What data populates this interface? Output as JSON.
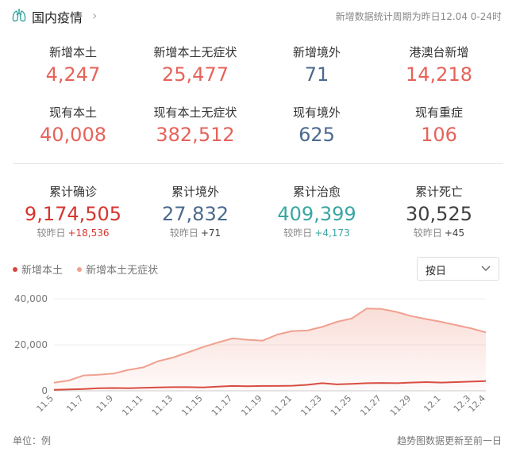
{
  "header": {
    "title": "国内疫情",
    "period": "新增数据统计周期为昨日12.04 0-24时"
  },
  "colors": {
    "red": "#e5635a",
    "blue": "#4a6a8e",
    "teal": "#3aa6a2",
    "dark": "#3f3f3f",
    "darkred": "#d6352f",
    "lightred": "#f0a08f"
  },
  "stats_new": [
    {
      "label": "新增本土",
      "value": "4,247",
      "color": "red"
    },
    {
      "label": "新增本土无症状",
      "value": "25,477",
      "color": "red"
    },
    {
      "label": "新增境外",
      "value": "71",
      "color": "blue"
    },
    {
      "label": "港澳台新增",
      "value": "14,218",
      "color": "red"
    }
  ],
  "stats_current": [
    {
      "label": "现有本土",
      "value": "40,008",
      "color": "red"
    },
    {
      "label": "现有本土无症状",
      "value": "382,512",
      "color": "red"
    },
    {
      "label": "现有境外",
      "value": "625",
      "color": "blue"
    },
    {
      "label": "现有重症",
      "value": "106",
      "color": "red"
    }
  ],
  "stats_total": [
    {
      "label": "累计确诊",
      "value": "9,174,505",
      "diff_label": "较昨日",
      "diff": "+18,536",
      "color": "darkred",
      "diffcolor": "darkred"
    },
    {
      "label": "累计境外",
      "value": "27,832",
      "diff_label": "较昨日",
      "diff": "+71",
      "color": "blue",
      "diffcolor": "dark"
    },
    {
      "label": "累计治愈",
      "value": "409,399",
      "diff_label": "较昨日",
      "diff": "+4,173",
      "color": "teal",
      "diffcolor": "teal"
    },
    {
      "label": "累计死亡",
      "value": "30,525",
      "diff_label": "较昨日",
      "diff": "+45",
      "color": "dark",
      "diffcolor": "dark"
    }
  ],
  "legend": [
    {
      "label": "新增本土",
      "color": "#d6473c"
    },
    {
      "label": "新增本土无症状",
      "color": "#f0a08f"
    }
  ],
  "select": {
    "value": "按日"
  },
  "footer": {
    "left": "单位：例",
    "right": "趋势图数据更新至前一日"
  },
  "chart_data": {
    "type": "area",
    "x": [
      "11.5",
      "11.6",
      "11.7",
      "11.8",
      "11.9",
      "11.10",
      "11.11",
      "11.12",
      "11.13",
      "11.14",
      "11.15",
      "11.16",
      "11.17",
      "11.18",
      "11.19",
      "11.20",
      "11.21",
      "11.22",
      "11.23",
      "11.24",
      "11.25",
      "11.26",
      "11.27",
      "11.28",
      "11.29",
      "11.30",
      "12.1",
      "12.2",
      "12.3",
      "12.4"
    ],
    "x_tick_labels": [
      "11.5",
      "11.7",
      "11.9",
      "11.11",
      "11.13",
      "11.15",
      "11.17",
      "11.19",
      "11.21",
      "11.23",
      "11.25",
      "11.27",
      "11.29",
      "12.1",
      "12.3",
      "12.4"
    ],
    "y_tick_labels": [
      "0",
      "20,000",
      "40,000"
    ],
    "ylim": [
      0,
      40000
    ],
    "series": [
      {
        "name": "新增本土",
        "color": "#d6473c",
        "values": [
          400,
          600,
          800,
          1100,
          1200,
          1100,
          1300,
          1500,
          1600,
          1600,
          1500,
          1800,
          2100,
          2000,
          2100,
          2100,
          2200,
          2600,
          3300,
          2800,
          3000,
          3300,
          3400,
          3300,
          3600,
          3800,
          3600,
          3800,
          4000,
          4200
        ]
      },
      {
        "name": "新增本土无症状",
        "color": "#f0a08f",
        "values": [
          3500,
          4500,
          6700,
          7000,
          7500,
          9100,
          10200,
          12900,
          14500,
          16700,
          19000,
          21000,
          22800,
          22200,
          21800,
          24500,
          26000,
          26200,
          27800,
          30000,
          31500,
          35800,
          35600,
          34300,
          32500,
          31200,
          30000,
          28600,
          27200,
          25400
        ]
      }
    ],
    "grid": true
  }
}
